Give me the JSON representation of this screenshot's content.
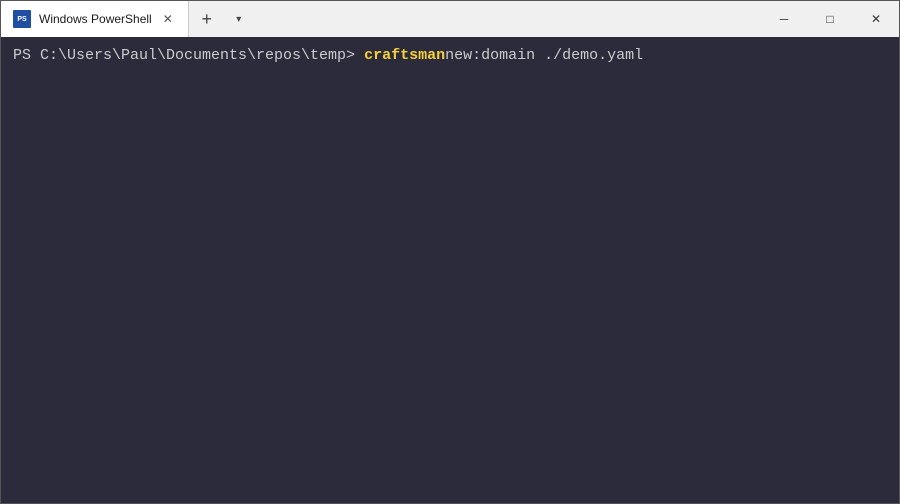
{
  "titlebar": {
    "tab_label": "Windows PowerShell",
    "tab_close_char": "✕",
    "new_tab_char": "+",
    "dropdown_char": "▾",
    "minimize_char": "─",
    "maximize_char": "□",
    "close_char": "✕"
  },
  "terminal": {
    "prompt": "PS C:\\Users\\Paul\\Documents\\repos\\temp>",
    "command_highlight": "craftsman",
    "command_rest": " new:domain ./demo.yaml"
  }
}
